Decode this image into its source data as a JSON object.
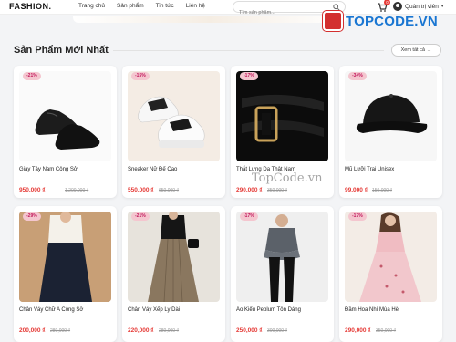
{
  "header": {
    "logo": "FASHION.",
    "nav": [
      "Trang chủ",
      "Sản phẩm",
      "Tin tức",
      "Liên hệ"
    ],
    "search_placeholder": "Tìm sản phẩm...",
    "cart_count": "0",
    "user_label": "Quản trị viên"
  },
  "watermark": {
    "text": "TOPCODE.VN",
    "overlay": "TopCode.vn"
  },
  "section": {
    "title": "Sản Phẩm Mới Nhất",
    "see_all": "Xem tất cả"
  },
  "products": [
    {
      "name": "Giày Tây Nam Công Sở",
      "price": "950,000 ₫",
      "old_price": "1,200,000 ₫",
      "discount": "-21%"
    },
    {
      "name": "Sneaker Nữ Đế Cao",
      "price": "550,000 ₫",
      "old_price": "650,000 ₫",
      "discount": "-15%"
    },
    {
      "name": "Thắt Lưng Da Thật Nam",
      "price": "290,000 ₫",
      "old_price": "350,000 ₫",
      "discount": "-17%"
    },
    {
      "name": "Mũ Lưỡi Trai Unisex",
      "price": "99,000 ₫",
      "old_price": "150,000 ₫",
      "discount": "-34%"
    },
    {
      "name": "Chân Váy Chữ A Công Sở",
      "price": "200,000 ₫",
      "old_price": "280,000 ₫",
      "discount": "-29%"
    },
    {
      "name": "Chân Váy Xếp Ly Dài",
      "price": "220,000 ₫",
      "old_price": "280,000 ₫",
      "discount": "-21%"
    },
    {
      "name": "Áo Kiểu Peplum Tôn Dáng",
      "price": "250,000 ₫",
      "old_price": "300,000 ₫",
      "discount": "-17%"
    },
    {
      "name": "Đầm Hoa Nhí Mùa Hè",
      "price": "290,000 ₫",
      "old_price": "350,000 ₫",
      "discount": "-17%"
    }
  ]
}
